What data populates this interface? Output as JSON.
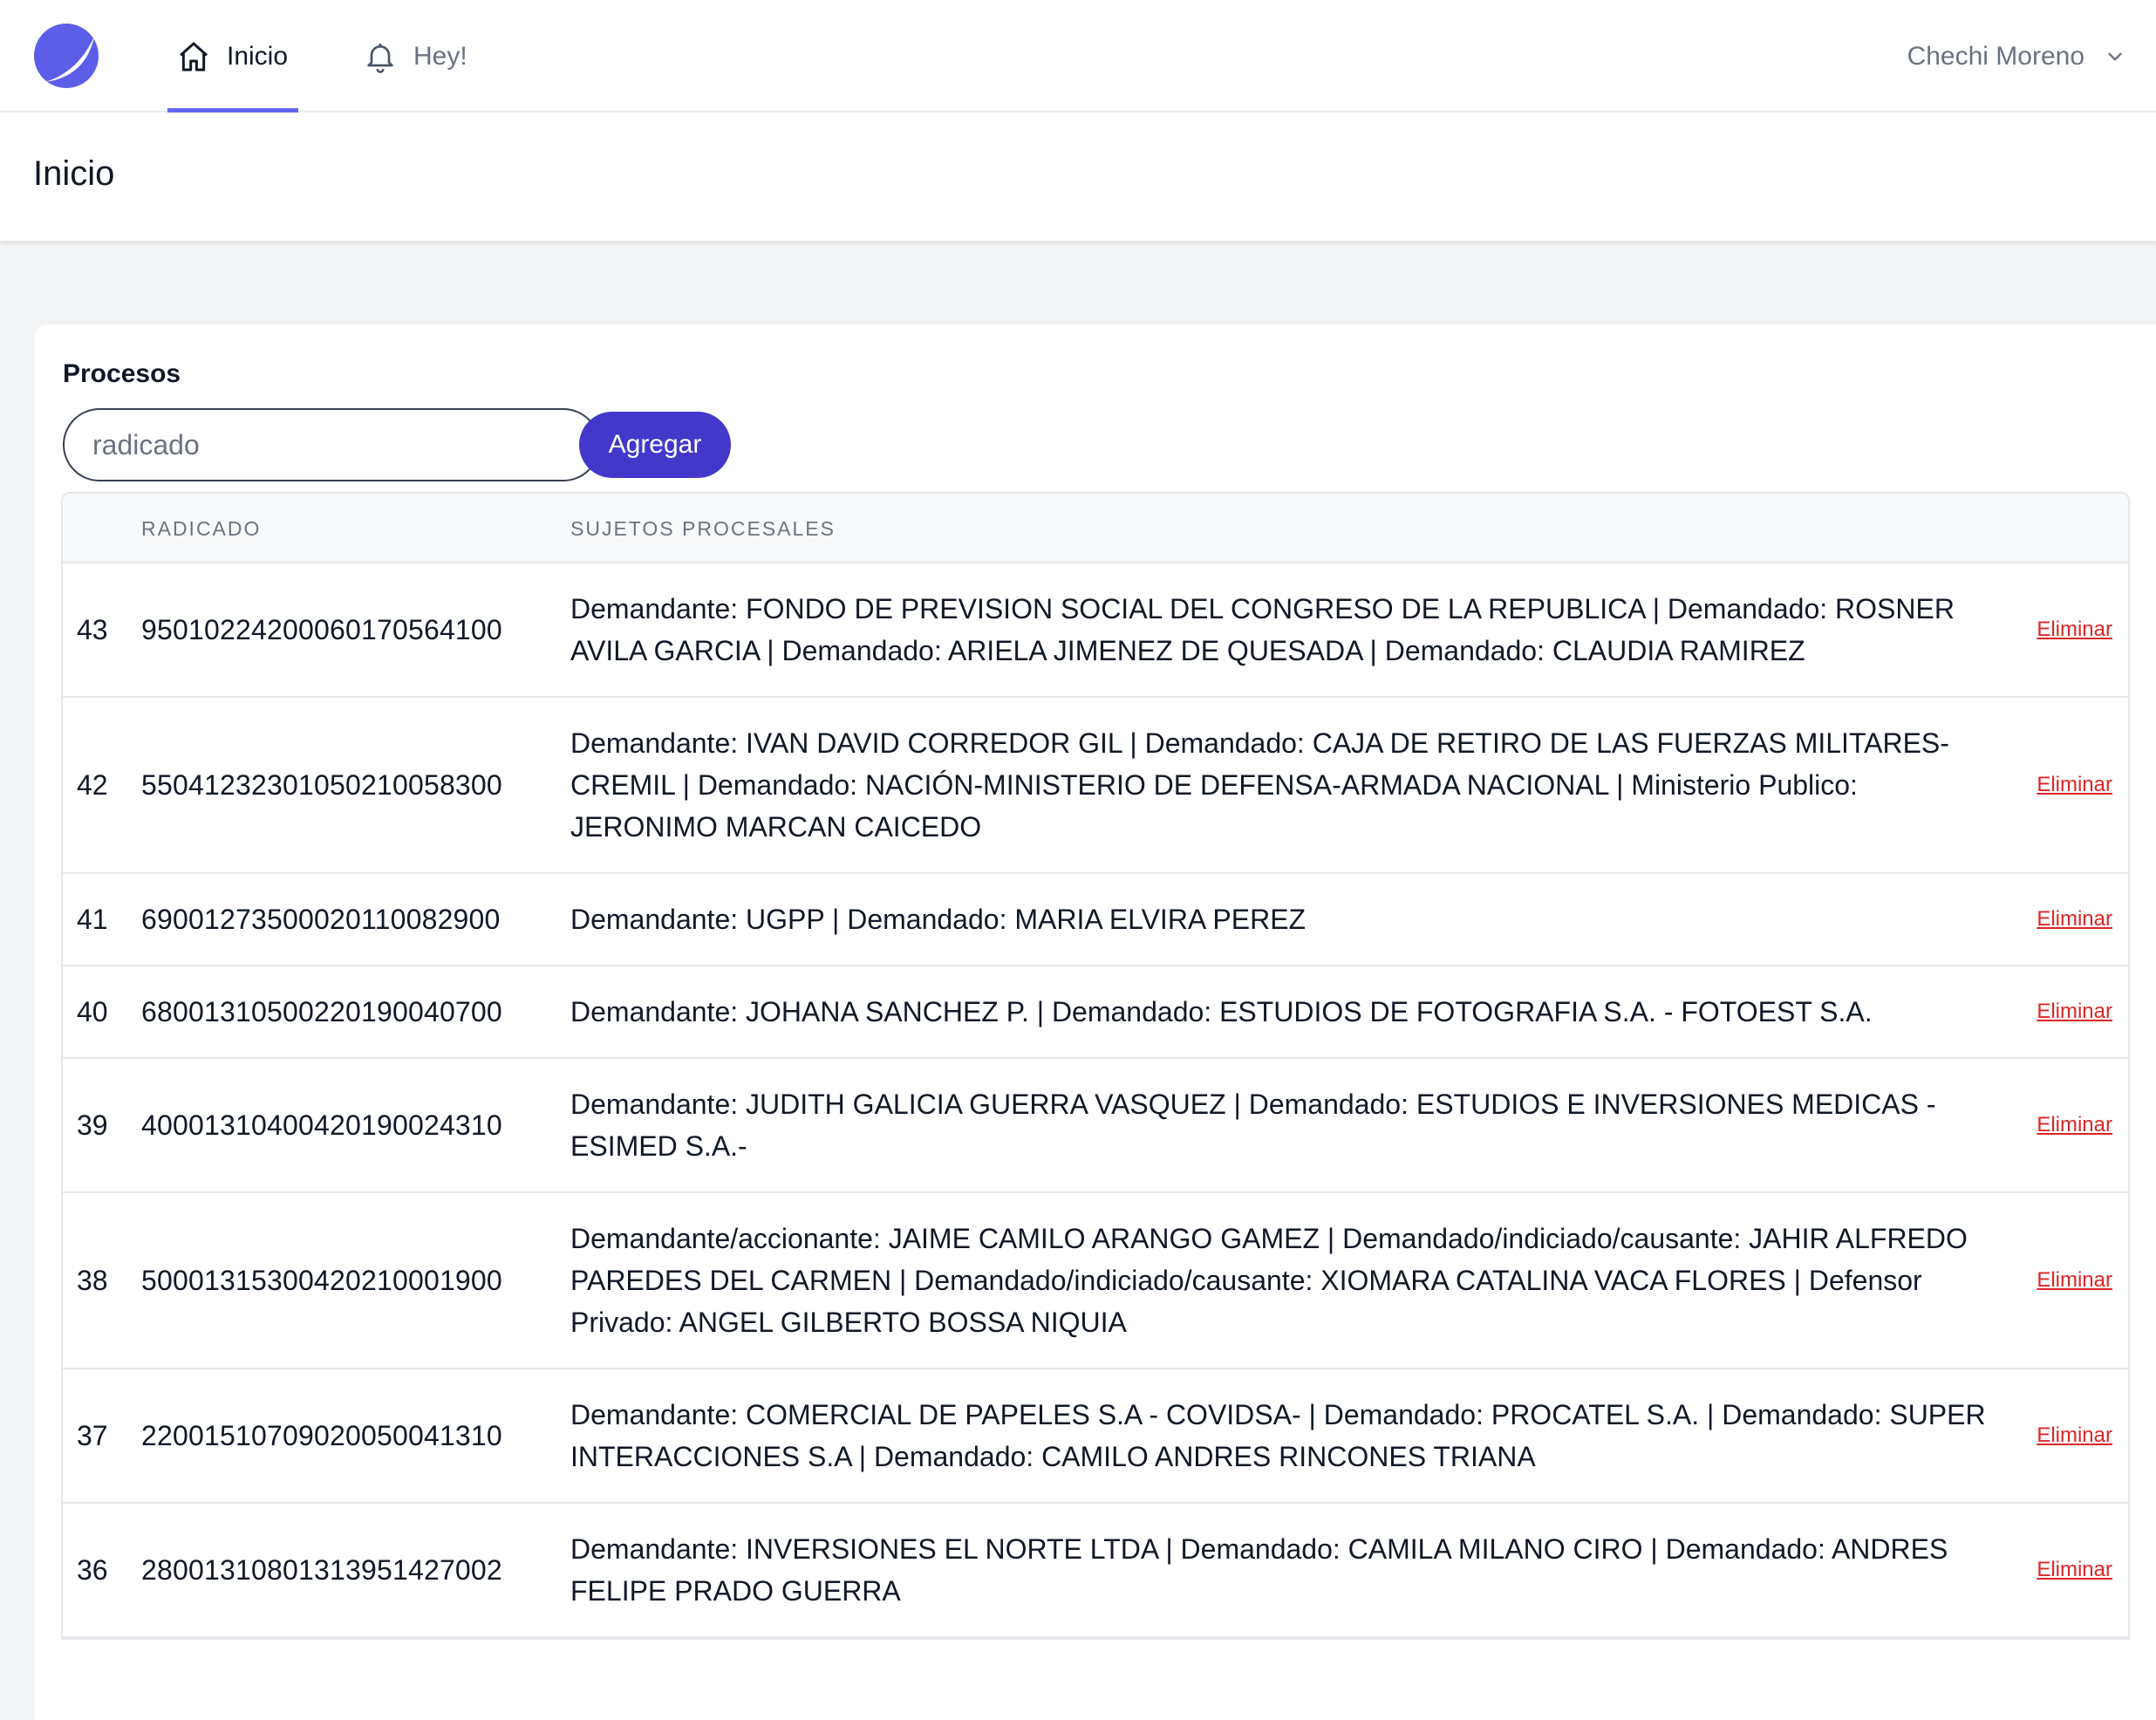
{
  "nav": {
    "home_label": "Inicio",
    "notifications_label": "Hey!",
    "user_name": "Chechi Moreno",
    "accent_color": "#6366f1"
  },
  "header": {
    "title": "Inicio"
  },
  "card": {
    "title": "Procesos",
    "search": {
      "placeholder": "radicado",
      "value": ""
    },
    "add_label": "Agregar"
  },
  "table": {
    "columns": [
      "",
      "RADICADO",
      "SUJETOS PROCESALES",
      ""
    ],
    "action_label": "Eliminar",
    "rows": [
      {
        "id": "43",
        "radicado": "95010224200060170564100",
        "sujetos": "Demandante: FONDO DE PREVISION SOCIAL DEL CONGRESO DE LA REPUBLICA | Demandado: ROSNER AVILA GARCIA | Demandado: ARIELA JIMENEZ DE QUESADA | Demandado: CLAUDIA RAMIREZ",
        "action": "Eliminar"
      },
      {
        "id": "42",
        "radicado": "55041232301050210058300",
        "sujetos": "Demandante: IVAN DAVID CORREDOR GIL | Demandado: CAJA DE RETIRO DE LAS FUERZAS MILITARES-CREMIL | Demandado: NACIÓN-MINISTERIO DE DEFENSA-ARMADA NACIONAL | Ministerio Publico: JERONIMO MARCAN CAICEDO",
        "action": "Eliminar"
      },
      {
        "id": "41",
        "radicado": "69001273500020110082900",
        "sujetos": "Demandante: UGPP | Demandado: MARIA ELVIRA PEREZ",
        "action": "Eliminar"
      },
      {
        "id": "40",
        "radicado": "68001310500220190040700",
        "sujetos": "Demandante: JOHANA SANCHEZ P. | Demandado: ESTUDIOS DE FOTOGRAFIA S.A. - FOTOEST S.A.",
        "action": "Eliminar"
      },
      {
        "id": "39",
        "radicado": "40001310400420190024310",
        "sujetos": "Demandante: JUDITH GALICIA GUERRA VASQUEZ | Demandado: ESTUDIOS E INVERSIONES MEDICAS - ESIMED S.A.-",
        "action": "Eliminar"
      },
      {
        "id": "38",
        "radicado": "50001315300420210001900",
        "sujetos": "Demandante/accionante: JAIME CAMILO ARANGO GAMEZ | Demandado/indiciado/causante: JAHIR ALFREDO PAREDES DEL CARMEN | Demandado/indiciado/causante: XIOMARA CATALINA VACA FLORES | Defensor Privado: ANGEL GILBERTO BOSSA NIQUIA",
        "action": "Eliminar"
      },
      {
        "id": "37",
        "radicado": "22001510709020050041310",
        "sujetos": "Demandante: COMERCIAL DE PAPELES S.A - COVIDSA- | Demandado: PROCATEL S.A. | Demandado: SUPER INTERACCIONES S.A | Demandado: CAMILO ANDRES RINCONES TRIANA",
        "action": "Eliminar"
      },
      {
        "id": "36",
        "radicado": "28001310801313951427002",
        "sujetos": "Demandante: INVERSIONES EL NORTE LTDA | Demandado: CAMILA MILANO CIRO | Demandado: ANDRES FELIPE PRADO GUERRA",
        "action": "Eliminar"
      }
    ]
  }
}
